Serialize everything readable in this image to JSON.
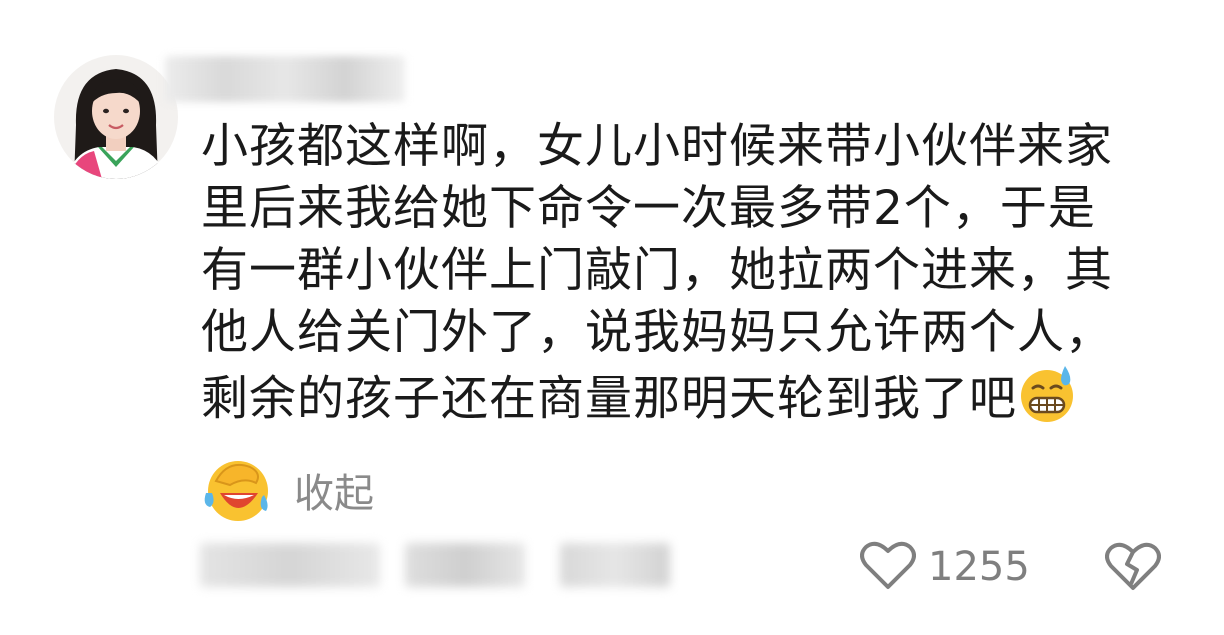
{
  "comment": {
    "author_avatar": "avatar-girl",
    "lines": [
      "小孩都这样啊，女儿小时候来带小伙伴来家",
      "里后来我给她下命令一次最多带2个，于是",
      "有一群小伙伴上门敲门，她拉两个进来，其",
      "他人给关门外了，说我妈妈只允许两个人，",
      "剩余的孩子还在商量那明天轮到我了吧"
    ],
    "trailing_emoji": "grimace-sweat-emoji",
    "second_emoji": "facepalm-laugh-emoji",
    "collapse_label": "收起",
    "like_icon": "heart-outline-icon",
    "like_count": "1255",
    "dislike_icon": "broken-heart-icon"
  },
  "colors": {
    "text": "#1a1a1a",
    "muted": "#8a8a8a",
    "icon": "#7f7f7f",
    "emoji_yellow": "#f9c230",
    "sweat_blue": "#5bb6e9"
  }
}
